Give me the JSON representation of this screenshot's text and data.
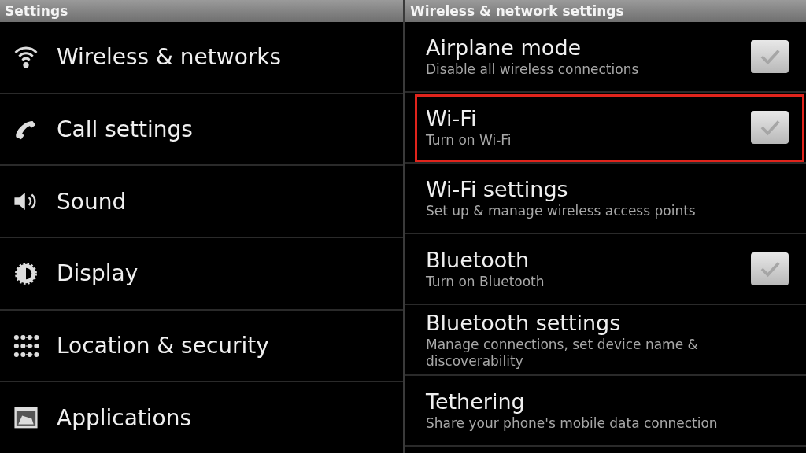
{
  "settings_panel": {
    "title": "Settings",
    "items": [
      {
        "label": "Wireless & networks"
      },
      {
        "label": "Call settings"
      },
      {
        "label": "Sound"
      },
      {
        "label": "Display"
      },
      {
        "label": "Location & security"
      },
      {
        "label": "Applications"
      }
    ]
  },
  "detail_panel": {
    "title": "Wireless & network settings",
    "items": [
      {
        "kind": "toggle",
        "title": "Airplane mode",
        "summary": "Disable all wireless connections",
        "checked": false,
        "highlighted": false
      },
      {
        "kind": "toggle",
        "title": "Wi-Fi",
        "summary": "Turn on Wi-Fi",
        "checked": false,
        "highlighted": true
      },
      {
        "kind": "link",
        "title": "Wi-Fi settings",
        "summary": "Set up & manage wireless access points",
        "highlighted": false
      },
      {
        "kind": "toggle",
        "title": "Bluetooth",
        "summary": "Turn on Bluetooth",
        "checked": false,
        "highlighted": false
      },
      {
        "kind": "link",
        "title": "Bluetooth settings",
        "summary": "Manage connections, set device name & discoverability",
        "highlighted": false
      },
      {
        "kind": "link",
        "title": "Tethering",
        "summary": "Share your phone's mobile data connection",
        "highlighted": false
      }
    ]
  }
}
